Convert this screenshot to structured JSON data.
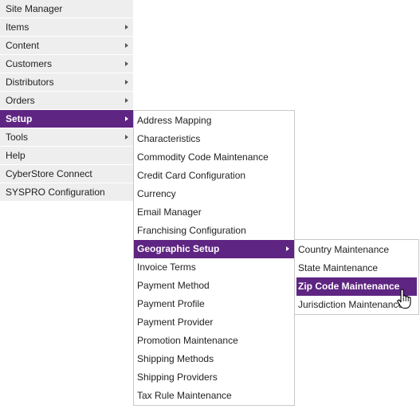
{
  "main_menu": {
    "items": [
      {
        "label": "Site Manager",
        "has_submenu": false
      },
      {
        "label": "Items",
        "has_submenu": true
      },
      {
        "label": "Content",
        "has_submenu": true
      },
      {
        "label": "Customers",
        "has_submenu": true
      },
      {
        "label": "Distributors",
        "has_submenu": true
      },
      {
        "label": "Orders",
        "has_submenu": true
      },
      {
        "label": "Setup",
        "has_submenu": true,
        "active": true
      },
      {
        "label": "Tools",
        "has_submenu": true
      },
      {
        "label": "Help",
        "has_submenu": false
      },
      {
        "label": "CyberStore Connect",
        "has_submenu": false
      },
      {
        "label": "SYSPRO Configuration",
        "has_submenu": false
      }
    ]
  },
  "setup_menu": {
    "items": [
      {
        "label": "Address Mapping"
      },
      {
        "label": "Characteristics"
      },
      {
        "label": "Commodity Code Maintenance"
      },
      {
        "label": "Credit Card Configuration"
      },
      {
        "label": "Currency"
      },
      {
        "label": "Email Manager"
      },
      {
        "label": "Franchising Configuration"
      },
      {
        "label": "Geographic Setup",
        "has_submenu": true,
        "active": true
      },
      {
        "label": "Invoice Terms"
      },
      {
        "label": "Payment Method"
      },
      {
        "label": "Payment Profile"
      },
      {
        "label": "Payment Provider"
      },
      {
        "label": "Promotion Maintenance"
      },
      {
        "label": "Shipping Methods"
      },
      {
        "label": "Shipping Providers"
      },
      {
        "label": "Tax Rule Maintenance"
      }
    ]
  },
  "geographic_menu": {
    "items": [
      {
        "label": "Country Maintenance"
      },
      {
        "label": "State Maintenance"
      },
      {
        "label": "Zip Code Maintenance",
        "active": true,
        "hovered": true
      },
      {
        "label": "Jurisdiction Maintenance"
      }
    ]
  },
  "cursor": {
    "icon": "hand-pointer-icon"
  },
  "colors": {
    "accent": "#5f2582",
    "menu_bg": "#eeeeee",
    "flyout_bg": "#ffffff",
    "flyout_border": "#c8c8c8",
    "text": "#222222"
  }
}
